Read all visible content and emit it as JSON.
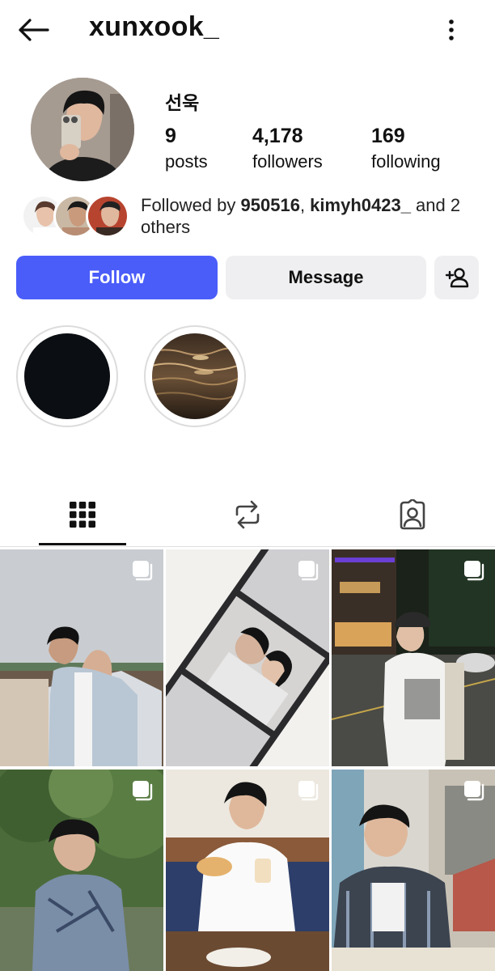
{
  "header": {
    "username": "xunxook_",
    "back_icon": "arrow-left-icon",
    "more_icon": "more-vertical-icon"
  },
  "profile": {
    "display_name": "선욱",
    "stats": [
      {
        "value": "9",
        "label": "posts"
      },
      {
        "value": "4,178",
        "label": "followers"
      },
      {
        "value": "169",
        "label": "following"
      }
    ],
    "followed_by": {
      "prefix": "Followed by ",
      "user1": "950516",
      "separator": ", ",
      "user2": "kimyh0423_",
      "suffix": " and 2 others"
    }
  },
  "actions": {
    "follow_label": "Follow",
    "message_label": "Message",
    "add_user_icon": "person-add-icon",
    "follow_color": "#4a5df9"
  },
  "highlights": [
    {
      "icon": "dark-circle"
    },
    {
      "icon": "water-sunset"
    }
  ],
  "tabs": [
    {
      "name": "posts",
      "icon": "grid-icon",
      "active": true
    },
    {
      "name": "reposts",
      "icon": "repost-icon",
      "active": false
    },
    {
      "name": "tagged",
      "icon": "tagged-icon",
      "active": false
    }
  ],
  "posts": [
    {
      "subject": "denim-jacket-overlook"
    },
    {
      "subject": "photo-booth-strip"
    },
    {
      "subject": "night-street-cap"
    },
    {
      "subject": "plaid-shirt-trees"
    },
    {
      "subject": "cafe-sandwich"
    },
    {
      "subject": "cafe-plaid-shirt"
    }
  ]
}
